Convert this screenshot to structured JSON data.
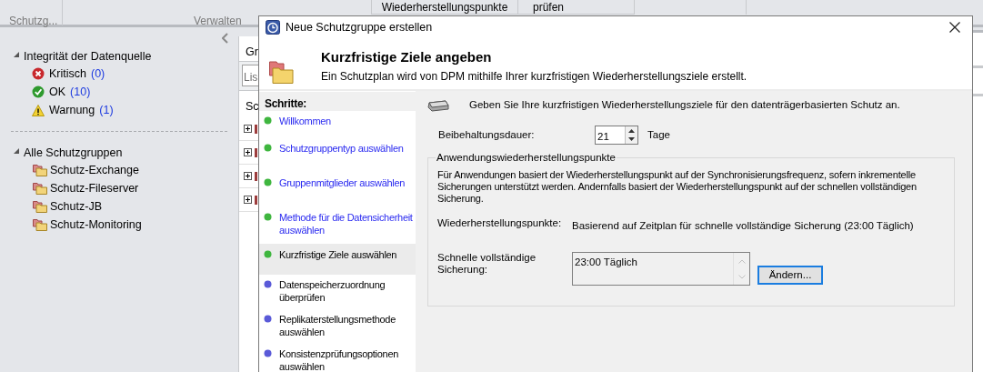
{
  "ribbon": {
    "groups": [
      "Schutzg...",
      "Verwalten"
    ],
    "buttons": [
      "Wiederherstellungspunkte",
      "prüfen"
    ]
  },
  "navigation": {
    "health": {
      "title": "Integrität der Datenquelle",
      "expanded": true,
      "items": [
        {
          "kind": "error",
          "label": "Kritisch",
          "count": "(0)"
        },
        {
          "kind": "ok",
          "label": "OK",
          "count": "(10)"
        },
        {
          "kind": "warning",
          "label": "Warnung",
          "count": "(1)"
        }
      ]
    },
    "groups": {
      "title": "Alle Schutzgruppen",
      "expanded": true,
      "items": [
        "Schutz-Exchange",
        "Schutz-Fileserver",
        "Schutz-JB",
        "Schutz-Monitoring"
      ]
    }
  },
  "middle_pane": {
    "header": "Gr",
    "search_placeholder": "Lis",
    "list_header": "Sc",
    "rows": [
      {
        "expanded": false
      },
      {
        "expanded": false
      },
      {
        "expanded": false
      },
      {
        "expanded": false
      }
    ]
  },
  "dialog": {
    "title": "Neue Schutzgruppe erstellen",
    "heading": "Kurzfristige Ziele angeben",
    "subtitle": "Ein Schutzplan wird von DPM mithilfe Ihrer kurzfristigen Wiederherstellungsziele erstellt.",
    "steps_title": "Schritte:",
    "steps": [
      {
        "label": "Willkommen",
        "done": true,
        "selected": false
      },
      {
        "label": "Schutzgruppentyp auswählen",
        "done": true,
        "selected": false
      },
      {
        "label": "Gruppenmitglieder auswählen",
        "done": true,
        "selected": false
      },
      {
        "label": "Methode für die Datensicherheit auswählen",
        "done": true,
        "selected": false
      },
      {
        "label": "Kurzfristige Ziele auswählen",
        "done": true,
        "selected": true
      },
      {
        "label": "Datenspeicherzuordnung überprüfen",
        "done": false,
        "selected": false
      },
      {
        "label": "Replikaterstellungsmethode auswählen",
        "done": false,
        "selected": false
      },
      {
        "label": "Konsistenzprüfungsoptionen auswählen",
        "done": false,
        "selected": false
      }
    ],
    "intro": "Geben Sie Ihre kurzfristigen Wiederherstellungsziele für den datenträgerbasierten Schutz an.",
    "retention": {
      "label": "Beibehaltungsdauer:",
      "value": "21",
      "unit": "Tage"
    },
    "app_points": {
      "title": "Anwendungswiederherstellungspunkte",
      "description": "Für Anwendungen basiert der Wiederherstellungspunkt auf der Synchronisierungsfrequenz, sofern inkrementelle Sicherungen unterstützt werden. Andernfalls basiert der Wiederherstellungspunkt auf der schnellen vollständigen Sicherung.",
      "points_label": "Wiederherstellungspunkte:",
      "points_value": "Basierend auf Zeitplan für schnelle vollständige Sicherung (23:00 Täglich)",
      "full_backup_label": "Schnelle vollständige Sicherung:",
      "full_backup_value": "23:00 Täglich",
      "change_button": "Ändern..."
    }
  }
}
